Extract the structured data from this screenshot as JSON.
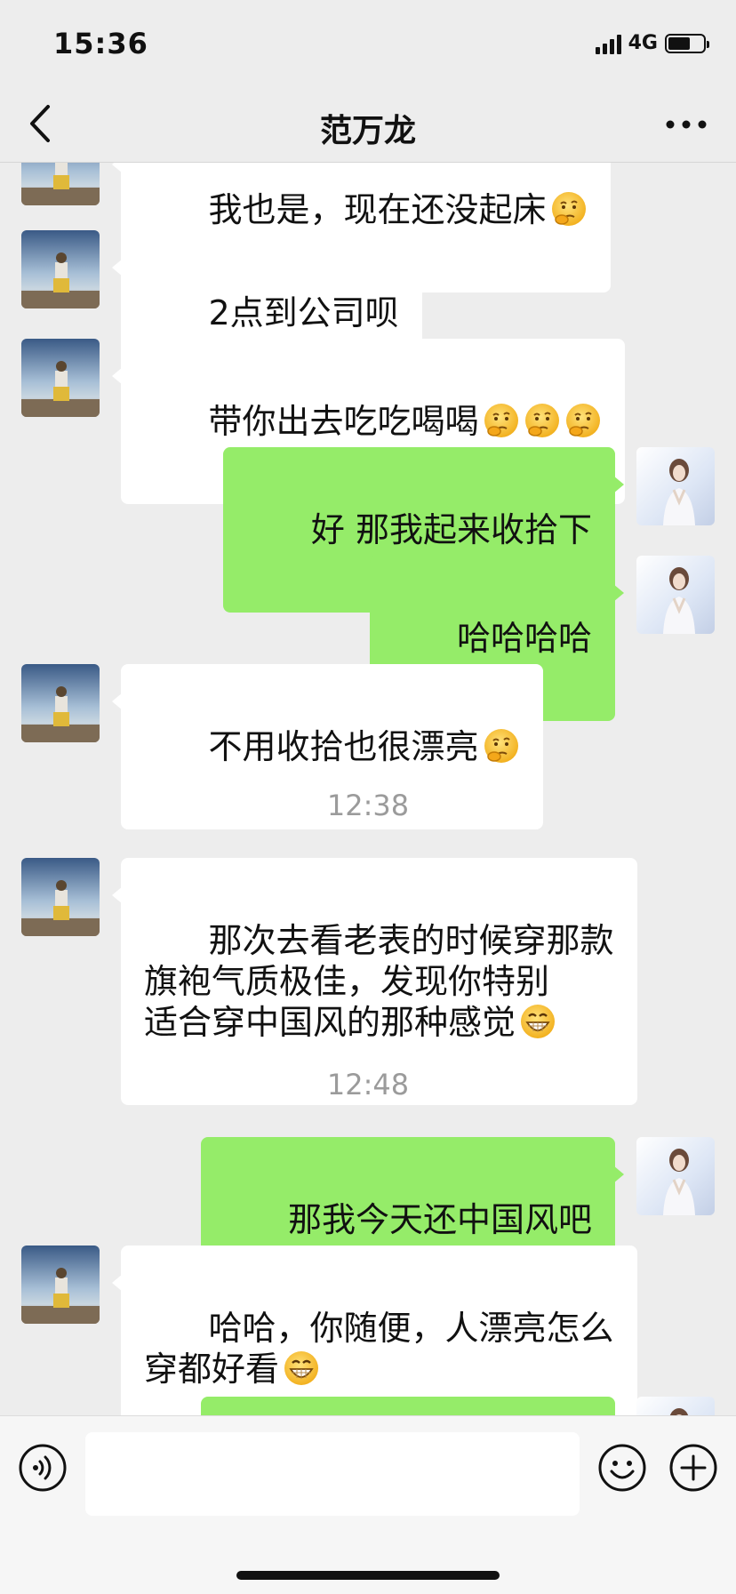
{
  "status_bar": {
    "time": "15:36",
    "network": "4G",
    "battery_level": 0.62
  },
  "header": {
    "title": "范万龙",
    "back_icon": "chevron-left-icon",
    "more_icon": "ellipsis-icon"
  },
  "messages": [
    {
      "side": "left",
      "text": "我也是，现在还没起床"
    },
    {
      "side": "left",
      "text": "2点到公司呗"
    },
    {
      "side": "left",
      "text": "带你出去吃吃喝喝"
    },
    {
      "side": "right",
      "text": "好 那我起来收拾下"
    },
    {
      "side": "right",
      "text": "哈哈哈哈"
    },
    {
      "side": "left",
      "text": "不用收拾也很漂亮"
    },
    {
      "type": "time",
      "text": "12:38"
    },
    {
      "side": "left",
      "text": "那次去看老表的时候穿那款\n旗袍气质极佳，发现你特别\n适合穿中国风的那种感觉"
    },
    {
      "type": "time",
      "text": "12:48"
    },
    {
      "side": "right",
      "text": "那我今天还中国风吧"
    },
    {
      "side": "left",
      "text": "哈哈，你随便，人漂亮怎么\n穿都好看"
    },
    {
      "side": "right",
      "text": ""
    }
  ],
  "input_bar": {
    "voice_icon": "voice-icon",
    "emoji_icon": "smiley-icon",
    "plus_icon": "plus-icon",
    "input_value": ""
  },
  "colors": {
    "background": "#ededed",
    "sent_bubble": "#95ec69",
    "received_bubble": "#ffffff",
    "timestamp_text": "#9b9b9b"
  }
}
